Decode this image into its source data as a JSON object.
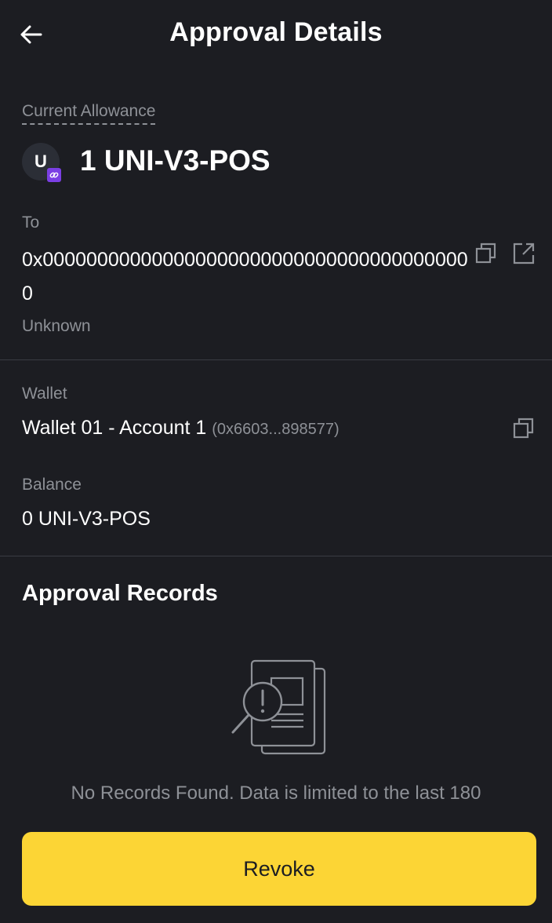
{
  "header": {
    "title": "Approval Details",
    "back_icon": "arrow-left-icon"
  },
  "allowance": {
    "label": "Current Allowance",
    "token_icon_letter": "U",
    "chain_badge_icon": "link-icon",
    "value": "1 UNI-V3-POS"
  },
  "recipient": {
    "label": "To",
    "address": "0x0000000000000000000000000000000000000000",
    "name": "Unknown",
    "copy_icon": "copy-icon",
    "external_icon": "external-link-icon"
  },
  "wallet": {
    "label": "Wallet",
    "name": "Wallet 01 - Account 1",
    "address_short": "(0x6603...898577)",
    "copy_icon": "copy-icon"
  },
  "balance": {
    "label": "Balance",
    "value": "0 UNI-V3-POS"
  },
  "records": {
    "title": "Approval Records",
    "empty_icon": "no-records-icon",
    "empty_text": "No Records Found. Data is limited to the last 180"
  },
  "actions": {
    "revoke_label": "Revoke"
  },
  "colors": {
    "background": "#1c1d22",
    "accent": "#fcd535",
    "muted_text": "#8e9197",
    "chain_badge": "#7b3fe4",
    "divider": "#3a3c43"
  }
}
